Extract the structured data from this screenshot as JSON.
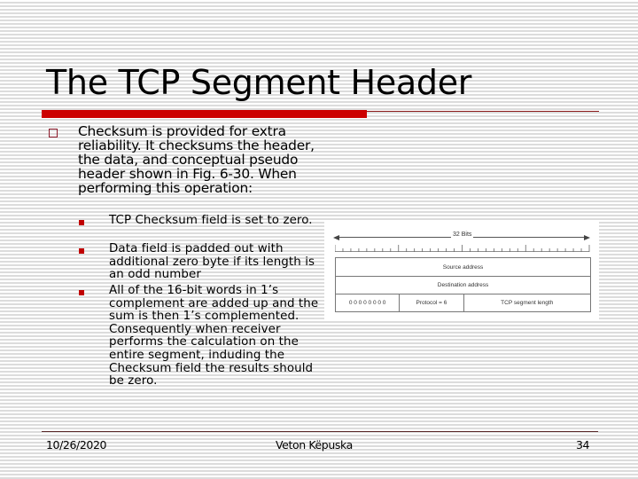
{
  "slide": {
    "title": "The TCP Segment Header",
    "accent_color": "#cc0000",
    "bullets": [
      {
        "text": "Checksum is provided for extra reliability. It checksums the header, the data, and conceptual pseudo header shown in Fig. 6-30. When performing this operation:",
        "sub_bullets": [
          {
            "text": "TCP Checksum field is set to zero."
          },
          {
            "text": "Data field is padded out with additional zero byte if its length is an odd number"
          },
          {
            "text": "All of the 16-bit words in 1’s complement are added up and the sum is then 1’s complemented. Consequently when receiver performs the calculation on the entire segment, induding the Checksum field the results should be zero."
          }
        ]
      }
    ],
    "figure": {
      "width_label": "32 Bits",
      "rows": [
        [
          "Source address"
        ],
        [
          "Destination address"
        ],
        [
          "0 0 0 0 0 0 0 0",
          "Protocol = 6",
          "TCP segment length"
        ]
      ]
    },
    "footer": {
      "date": "10/26/2020",
      "author": "Veton Këpuska",
      "page_number": "34"
    }
  }
}
